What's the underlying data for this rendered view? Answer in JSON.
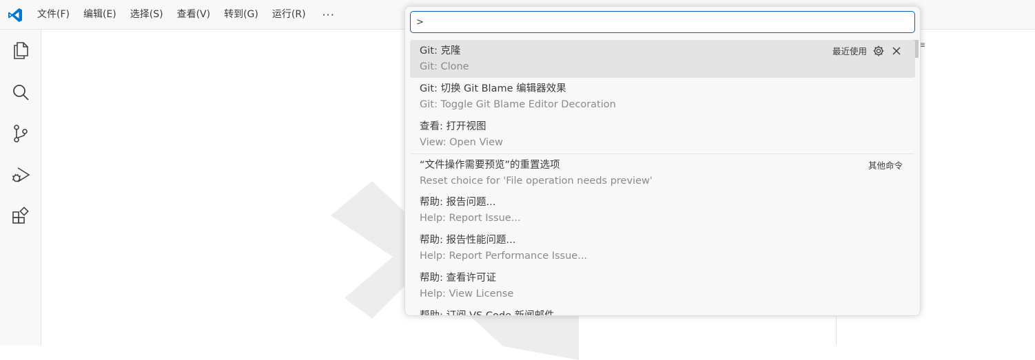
{
  "menu": {
    "items": [
      "文件(F)",
      "编辑(E)",
      "选择(S)",
      "查看(V)",
      "转到(G)",
      "运行(R)"
    ],
    "more": "···"
  },
  "activity_bar": {
    "icons": [
      "explorer-icon",
      "search-icon",
      "source-control-icon",
      "run-debug-icon",
      "extensions-icon"
    ]
  },
  "quick_input": {
    "value": ">",
    "items": [
      {
        "label": "Git: 克隆",
        "detail": "Git: Clone",
        "tag": "最近使用",
        "selected": true
      },
      {
        "label": "Git: 切换 Git Blame 编辑器效果",
        "detail": "Git: Toggle Git Blame Editor Decoration"
      },
      {
        "label": "查看: 打开视图",
        "detail": "View: Open View"
      },
      {
        "label": "“文件操作需要预览”的重置选项",
        "detail": "Reset choice for 'File operation needs preview'",
        "tag": "其他命令"
      },
      {
        "label": "帮助: 报告问题...",
        "detail": "Help: Report Issue..."
      },
      {
        "label": "帮助: 报告性能问题...",
        "detail": "Help: Report Performance Issue..."
      },
      {
        "label": "帮助: 查看许可证",
        "detail": "Help: View License"
      },
      {
        "label": "帮助: 订阅 VS Code 新闻邮件",
        "detail": ""
      }
    ]
  },
  "right_panel": {
    "glyph": "≡"
  },
  "colors": {
    "accent": "#005fb8",
    "logo": "#0078d4",
    "selection": "#e4e4e4",
    "watermark": "#ededed"
  }
}
